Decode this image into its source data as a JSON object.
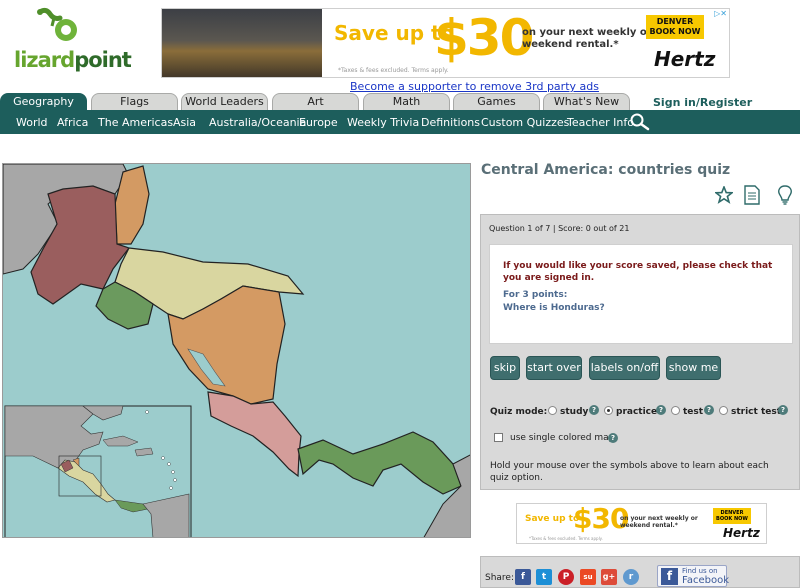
{
  "logo": {
    "word_part1": "lizard",
    "word_part2": "point"
  },
  "top_ad": {
    "save_text": "Save up to",
    "amount": "$30",
    "description": "on your next weekly or weekend rental.*",
    "fees": "*Taxes & fees excluded. Terms apply.",
    "cta": "DENVER BOOK NOW",
    "brand": "Hertz"
  },
  "supporter_link": "Become a supporter to remove 3rd party ads",
  "tabs": [
    {
      "label": "Geography",
      "active": true
    },
    {
      "label": "Flags",
      "active": false
    },
    {
      "label": "World Leaders",
      "active": false
    },
    {
      "label": "Art",
      "active": false
    },
    {
      "label": "Math",
      "active": false
    },
    {
      "label": "Games",
      "active": false
    },
    {
      "label": "What's New",
      "active": false
    }
  ],
  "signin": "Sign in/Register",
  "nav": [
    "World",
    "Africa",
    "The Americas",
    "Asia",
    "Australia/Oceania",
    "Europe",
    "Weekly Trivia",
    "Definitions",
    "Custom Quizzes",
    "Teacher Info"
  ],
  "quiz": {
    "title": "Central America: countries quiz",
    "status": "Question 1 of 7 | Score: 0 out of 21",
    "save_note": "If you would like your score saved, please check that you are signed in.",
    "points": "For 3 points:",
    "question": "Where is Honduras?",
    "buttons": [
      "skip",
      "start over",
      "labels on/off",
      "show me"
    ],
    "mode_label": "Quiz mode:",
    "modes": [
      {
        "label": "study",
        "selected": false
      },
      {
        "label": "practice",
        "selected": true
      },
      {
        "label": "test",
        "selected": false
      },
      {
        "label": "strict test",
        "selected": false
      }
    ],
    "single_color_label": "use single colored map",
    "hover_help": "Hold your mouse over the  symbols above to learn about each quiz option."
  },
  "bottom_ad": {
    "save_text": "Save up to",
    "amount": "$30",
    "description": "on your next weekly or weekend rental.*",
    "fees": "*Taxes & fees excluded. Terms apply.",
    "cta": "DENVER BOOK NOW",
    "brand": "Hertz"
  },
  "share": {
    "label": "Share:",
    "icons": [
      {
        "name": "facebook-icon",
        "glyph": "f",
        "color": "#3b5998"
      },
      {
        "name": "twitter-icon",
        "glyph": "t",
        "color": "#1d8fd6"
      },
      {
        "name": "pinterest-icon",
        "glyph": "P",
        "color": "#cb2027"
      },
      {
        "name": "stumbleupon-icon",
        "glyph": "su",
        "color": "#eb4924"
      },
      {
        "name": "googleplus-icon",
        "glyph": "g+",
        "color": "#dd4b39"
      },
      {
        "name": "reddit-icon",
        "glyph": "r",
        "color": "#5f99cf"
      }
    ],
    "fb_find_line1": "Find us on",
    "fb_find_line2": "Facebook"
  },
  "colors": {
    "nav_bg": "#1d5e5c",
    "ocean": "#9ccccc",
    "guatemala": "#9a5e5e",
    "belize": "#d39a63",
    "honduras": "#d9d6a0",
    "el_salvador": "#6b9a5e",
    "nicaragua": "#d49a63",
    "costa_rica": "#d49d9a",
    "panama": "#6a9a5a",
    "outside_land": "#a7a7a7"
  }
}
